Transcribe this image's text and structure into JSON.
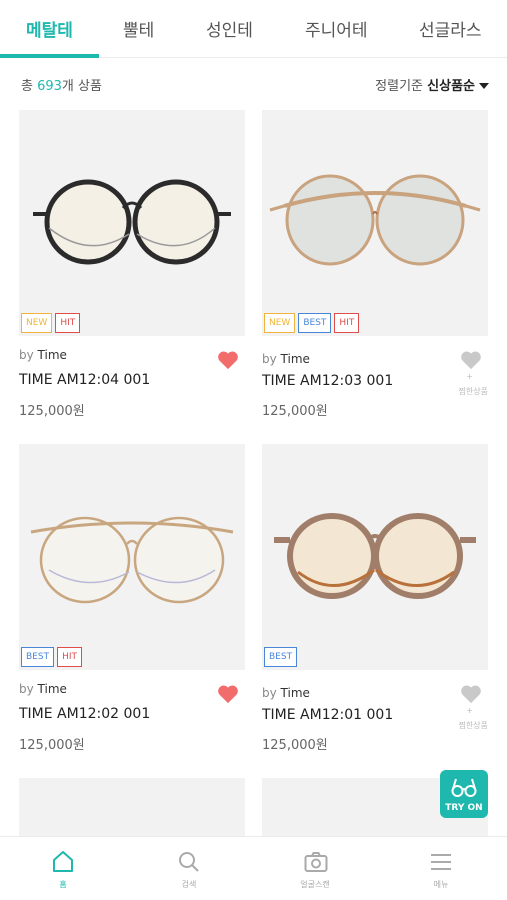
{
  "tabs": [
    {
      "label": "메탈테",
      "active": true
    },
    {
      "label": "뿔테",
      "active": false
    },
    {
      "label": "성인테",
      "active": false
    },
    {
      "label": "주니어테",
      "active": false
    },
    {
      "label": "선글라스",
      "active": false
    }
  ],
  "sortbar": {
    "count_prefix": "총 ",
    "count": "693",
    "count_suffix": "개 상품",
    "sort_label": "정렬기준 ",
    "sort_value": "신상품순"
  },
  "products": [
    {
      "brand_prefix": "by ",
      "brand": "Time",
      "name": "TIME AM12:04 001",
      "price": "125,000원",
      "badges": [
        "NEW",
        "HIT"
      ],
      "wished": true,
      "wish_label": "",
      "frame_color": "#2b2b2b"
    },
    {
      "brand_prefix": "by ",
      "brand": "Time",
      "name": "TIME AM12:03 001",
      "price": "125,000원",
      "badges": [
        "NEW",
        "BEST",
        "HIT"
      ],
      "wished": false,
      "wish_label": "찜한상품",
      "frame_color": "#c9a27e"
    },
    {
      "brand_prefix": "by ",
      "brand": "Time",
      "name": "TIME AM12:02 001",
      "price": "125,000원",
      "badges": [
        "BEST",
        "HIT"
      ],
      "wished": true,
      "wish_label": "",
      "frame_color": "#c8a67f"
    },
    {
      "brand_prefix": "by ",
      "brand": "Time",
      "name": "TIME AM12:01 001",
      "price": "125,000원",
      "badges": [
        "BEST"
      ],
      "wished": false,
      "wish_label": "찜한상품",
      "frame_color": "#a07e6a"
    }
  ],
  "tryon": {
    "label": "TRY ON"
  },
  "bottom_nav": [
    {
      "label": "홈",
      "icon": "home-icon",
      "active": true
    },
    {
      "label": "검색",
      "icon": "search-icon",
      "active": false
    },
    {
      "label": "얼굴스캔",
      "icon": "camera-icon",
      "active": false
    },
    {
      "label": "메뉴",
      "icon": "menu-icon",
      "active": false
    }
  ],
  "colors": {
    "accent": "#1fb8ae",
    "heart_active": "#f26c6c",
    "heart_inactive": "#c9c9c9"
  }
}
